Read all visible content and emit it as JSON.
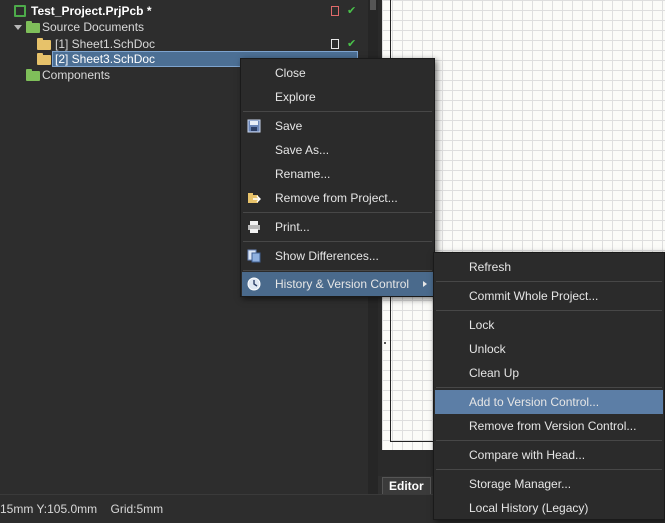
{
  "project_tree": {
    "project_label": "Test_Project.PrjPcb *",
    "source_folder_label": "Source Documents",
    "documents": [
      {
        "label": "[1] Sheet1.SchDoc"
      },
      {
        "label": "[2] Sheet3.SchDoc"
      }
    ],
    "components_label": "Components"
  },
  "editor": {
    "tab_label": "Editor"
  },
  "status_bar": {
    "text": "15mm Y:105.0mm    Grid:5mm"
  },
  "context_menu": {
    "items": [
      {
        "label": "Close",
        "icon": ""
      },
      {
        "label": "Explore",
        "icon": ""
      },
      {
        "label": "Save",
        "icon": "save-icon"
      },
      {
        "label": "Save As...",
        "icon": ""
      },
      {
        "label": "Rename...",
        "icon": ""
      },
      {
        "label": "Remove from Project...",
        "icon": "remove-from-project-icon"
      },
      {
        "label": "Print...",
        "icon": "print-icon"
      },
      {
        "label": "Show Differences...",
        "icon": "show-differences-icon"
      },
      {
        "label": "History & Version Control",
        "icon": "clock-icon"
      }
    ]
  },
  "submenu": {
    "items": [
      {
        "label": "Refresh"
      },
      {
        "label": "Commit Whole Project..."
      },
      {
        "label": "Lock"
      },
      {
        "label": "Unlock"
      },
      {
        "label": "Clean Up"
      },
      {
        "label": "Add to Version Control..."
      },
      {
        "label": "Remove from Version Control..."
      },
      {
        "label": "Compare with Head..."
      },
      {
        "label": "Storage Manager..."
      },
      {
        "label": "Local History (Legacy)"
      }
    ]
  },
  "colors": {
    "menu_highlight": "#4a6a8c",
    "submenu_highlight": "#5c7ea6",
    "status_ok": "#49c24a"
  }
}
